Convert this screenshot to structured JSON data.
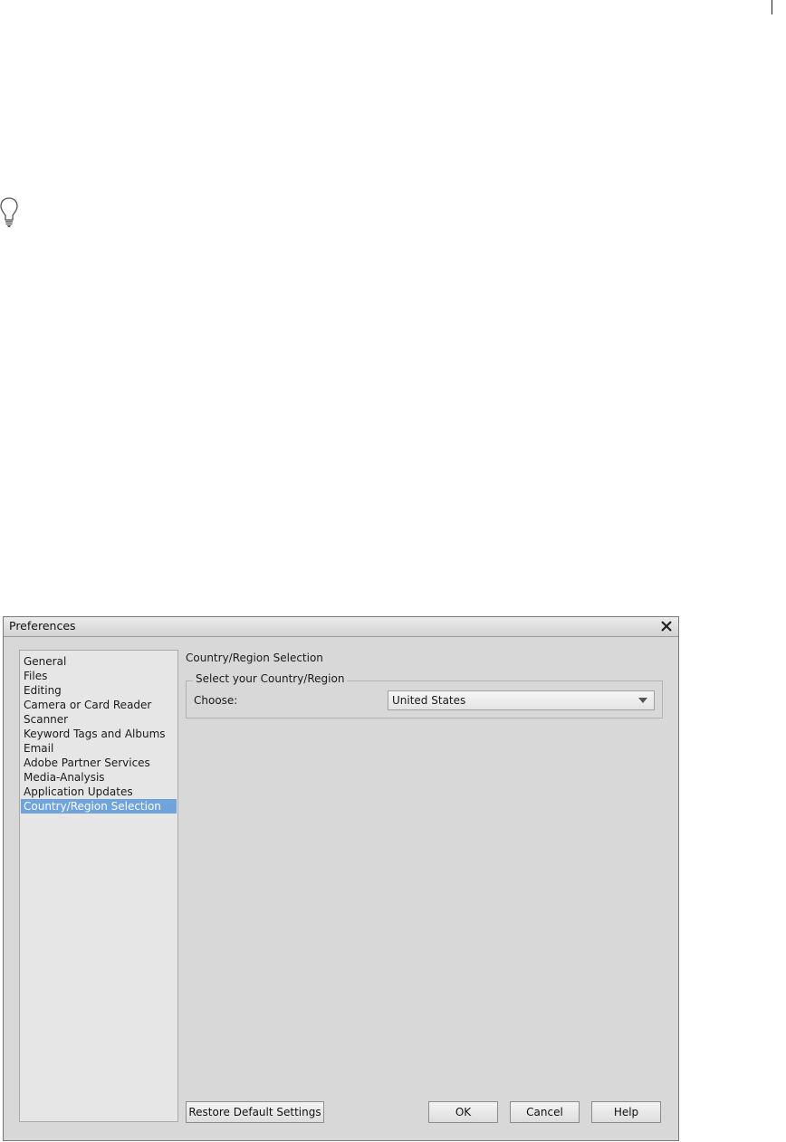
{
  "dialog": {
    "title": "Preferences",
    "nav_items": [
      {
        "label": "General"
      },
      {
        "label": "Files"
      },
      {
        "label": "Editing"
      },
      {
        "label": "Camera or Card Reader"
      },
      {
        "label": "Scanner"
      },
      {
        "label": "Keyword Tags and Albums"
      },
      {
        "label": "Email"
      },
      {
        "label": "Adobe Partner Services"
      },
      {
        "label": "Media-Analysis"
      },
      {
        "label": "Application Updates"
      },
      {
        "label": "Country/Region Selection",
        "selected": true
      }
    ],
    "section_title": "Country/Region Selection",
    "group": {
      "legend": "Select your Country/Region",
      "choose_label": "Choose:",
      "selected_value": "United States"
    },
    "buttons": {
      "restore": "Restore Default Settings",
      "ok": "OK",
      "cancel": "Cancel",
      "help": "Help"
    }
  },
  "colors": {
    "selection": "#6fa3db",
    "dialog_bg": "#d8d8d8"
  },
  "icons": {
    "tip": "lightbulb-icon",
    "close": "close-icon",
    "dropdown": "chevron-down-icon"
  }
}
